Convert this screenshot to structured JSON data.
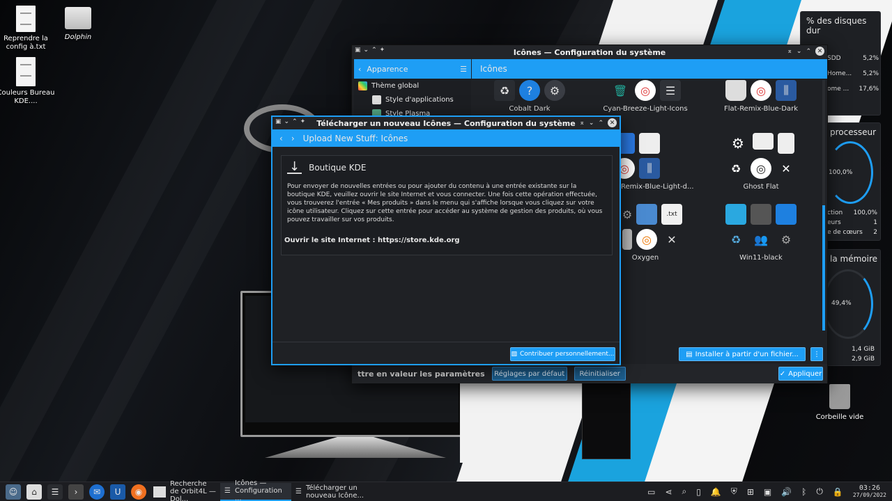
{
  "desktop": {
    "icons": [
      {
        "label": "Reprendre la config à.txt"
      },
      {
        "label": "Dolphin"
      },
      {
        "label": "Couleurs Bureau KDE...."
      },
      {
        "label": "Corbeille vide"
      }
    ]
  },
  "widgets": {
    "disks": {
      "title": "% des disques dur",
      "rows": [
        {
          "name": "SDD",
          "value": "5,2%"
        },
        {
          "name": "Home...",
          "value": "5,2%"
        },
        {
          "name": "ome ...",
          "value": "17,6%"
        }
      ]
    },
    "cpu": {
      "title": "processeur",
      "center": "100,0%",
      "rows": [
        {
          "name": "ction",
          "value": "100,0%"
        },
        {
          "name": "eurs",
          "value": "1"
        },
        {
          "name": "e de cœurs",
          "value": "2"
        }
      ]
    },
    "memory": {
      "title": "la mémoire",
      "center": "49,4%",
      "rows": [
        {
          "value": "1,4 GiB"
        },
        {
          "value": "2,9 GiB"
        }
      ]
    }
  },
  "syswin": {
    "title": "Icônes — Configuration du système",
    "back_label": "Apparence",
    "page_title": "Icônes",
    "sidebar": [
      {
        "label": "Thème global"
      },
      {
        "label": "Style d'applications"
      },
      {
        "label": "Style Plasma"
      }
    ],
    "themes": [
      {
        "name": "Cobalt Dark"
      },
      {
        "name": "Cyan-Breeze-Light-Icons"
      },
      {
        "name": "Flat-Remix-Blue-Dark"
      },
      {
        "name": "Remix-Blue-Light-d..."
      },
      {
        "name": "Ghost Flat"
      },
      {
        "name": "Oxygen"
      },
      {
        "name": "Win11-black"
      }
    ],
    "install_file": "Installer à partir d'un fichier...",
    "highlight_label": "ttre en valeur les paramètres",
    "defaults_btn": "Réglages par défaut",
    "reset_btn": "Réinitialiser",
    "apply_btn": "Appliquer"
  },
  "dialog": {
    "title": "Télécharger un nouveau Icônes — Configuration du système",
    "header": "Upload New Stuff: Icônes",
    "store_title": "Boutique KDE",
    "paragraph": "Pour envoyer de nouvelles entrées ou pour ajouter du contenu à une entrée existante sur la boutique KDE, veuillez ouvrir le site Internet et vous connecter. Une fois cette opération effectuée, vous trouverez l'entrée « Mes produits » dans le menu qui s'affiche lorsque vous cliquez sur votre icône utilisateur. Cliquez sur cette entrée pour accéder au système de gestion des produits, où vous pouvez travailler sur vos produits.",
    "link": "Ouvrir le site Internet : https://store.kde.org",
    "contribute_btn": "Contribuer personnellement..."
  },
  "taskbar": {
    "tasks": [
      {
        "label": "Recherche de Orbit4L — Dol..."
      },
      {
        "label": "Icônes — Configuration ..."
      },
      {
        "label": "Télécharger un nouveau Icône..."
      }
    ],
    "clock": {
      "time": "03:26",
      "date": "27/09/2022"
    }
  },
  "colors": {
    "accent": "#1e9ef5",
    "panel": "#1f2125"
  }
}
